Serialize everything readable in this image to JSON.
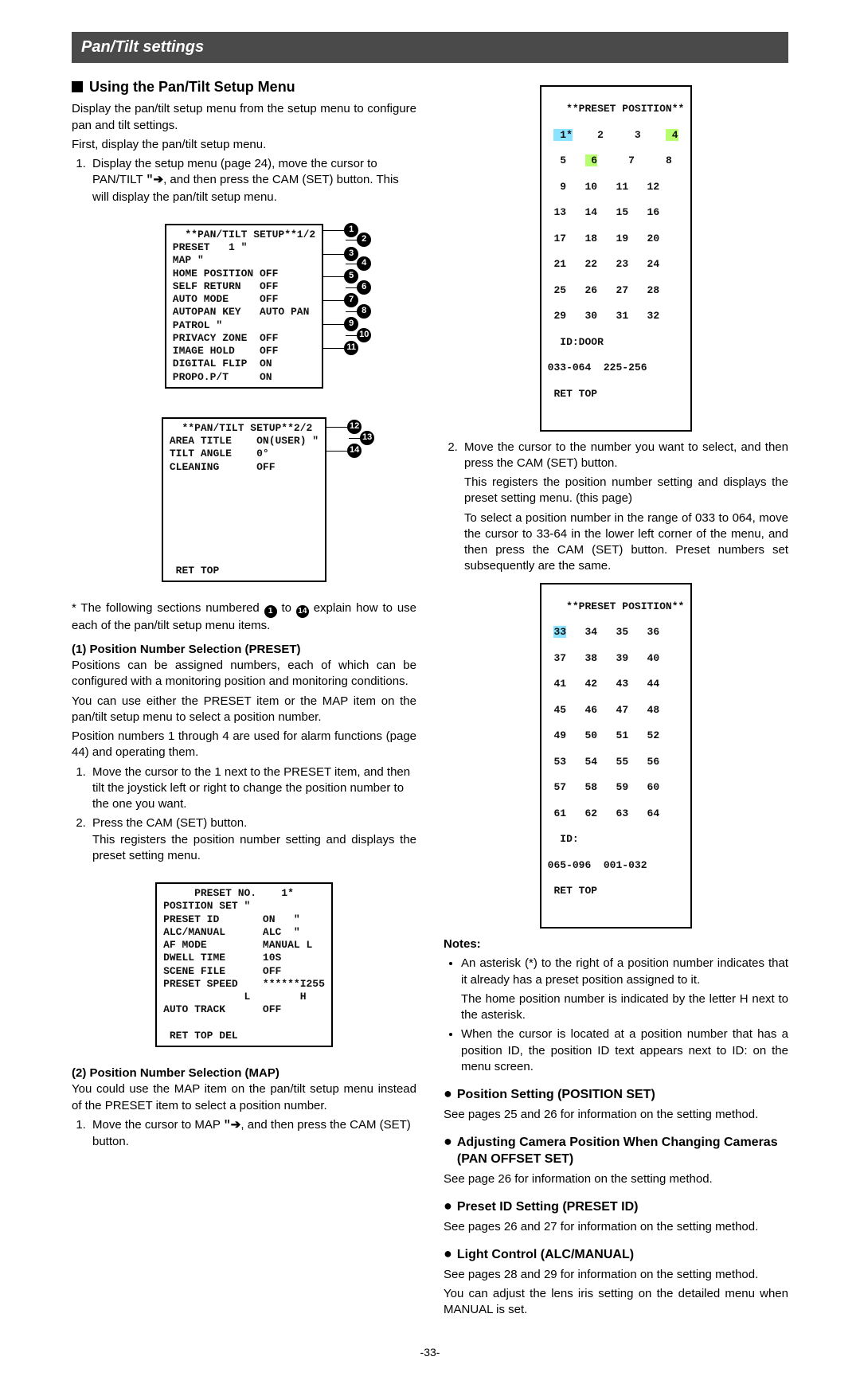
{
  "title_bar": "Pan/Tilt settings",
  "left": {
    "h2": "Using the Pan/Tilt Setup Menu",
    "intro1": "Display the pan/tilt setup menu from the setup menu to configure pan and tilt settings.",
    "intro2": "First, display the pan/tilt setup menu.",
    "step1a": "Display the setup menu (page 24), move the cursor to PAN/TILT ",
    "step1b": ", and then press the CAM (SET) button. This will display the pan/tilt setup menu.",
    "menu1": "  **PAN/TILT SETUP**1/2\nPRESET   1 \"\nMAP \"\nHOME POSITION OFF\nSELF RETURN   OFF\nAUTO MODE     OFF\nAUTOPAN KEY   AUTO PAN\nPATROL \"\nPRIVACY ZONE  OFF\nIMAGE HOLD    OFF\nDIGITAL FLIP  ON\nPROPO.P/T     ON",
    "menu2": "  **PAN/TILT SETUP**2/2\nAREA TITLE    ON(USER) \"\nTILT ANGLE    0°\nCLEANING      OFF\n\n\n\n\n\n\n\n RET TOP",
    "foot_a": " * The following sections numbered ",
    "foot_b": " to ",
    "foot_c": " explain how to use each of the pan/tilt setup menu items.",
    "sec1_title": "(1) Position Number Selection (PRESET)",
    "sec1_p1": "Positions can be assigned numbers, each of which can be configured with a monitoring position and monitoring conditions.",
    "sec1_p2": "You can use either the PRESET item or the MAP item on the pan/tilt setup menu to select a position number.",
    "sec1_p3": "Position numbers 1 through 4 are used for alarm functions (page 44) and operating them.",
    "sec1_step1": "Move the cursor to the 1 next to the PRESET item, and then tilt the joystick left or right to change the position number to the one you want.",
    "sec1_step2a": "Press the CAM (SET) button.",
    "sec1_step2b": "This registers the position number setting and displays the preset setting menu.",
    "preset_no_menu": "     PRESET NO.    1*  \nPOSITION SET \"\nPRESET ID       ON   \"\nALC/MANUAL      ALC  \"\nAF MODE         MANUAL L\nDWELL TIME      10S\nSCENE FILE      OFF\nPRESET SPEED    ******I255\n             L        H\nAUTO TRACK      OFF\n\n RET TOP DEL",
    "sec2_title": "(2) Position Number Selection (MAP)",
    "sec2_p1": "You could use the MAP item on the pan/tilt setup menu instead of the PRESET item to select a position number.",
    "sec2_step1a": "Move the cursor to MAP ",
    "sec2_step1b": ", and then press the CAM (SET) button."
  },
  "right": {
    "preset_pos_1_title": "**PRESET POSITION**",
    "preset_pos_1_rows": [
      [
        " 1*",
        " 2",
        " 3",
        " 4"
      ],
      [
        " 5",
        " 6",
        " 7",
        " 8"
      ],
      [
        " 9",
        "10",
        "11",
        "12"
      ],
      [
        "13",
        "14",
        "15",
        "16"
      ],
      [
        "17",
        "18",
        "19",
        "20"
      ],
      [
        "21",
        "22",
        "23",
        "24"
      ],
      [
        "25",
        "26",
        "27",
        "28"
      ],
      [
        "29",
        "30",
        "31",
        "32"
      ]
    ],
    "preset_pos_1_id": "  ID:DOOR",
    "preset_pos_1_range": "033-064  225-256",
    "preset_pos_1_ret": " RET TOP",
    "step2a": "Move the cursor to the number you want to select, and then press the CAM (SET) button.",
    "step2b": "This registers the position number setting and displays the preset setting menu. (this page)",
    "step2c": "To select a position number in the range of 033 to 064, move the cursor to 33-64 in the lower left corner of the menu, and then press the CAM (SET) button. Preset numbers set subsequently are the same.",
    "preset_pos_2_title": "**PRESET POSITION**",
    "preset_pos_2_rows": [
      [
        "33",
        "34",
        "35",
        "36"
      ],
      [
        "37",
        "38",
        "39",
        "40"
      ],
      [
        "41",
        "42",
        "43",
        "44"
      ],
      [
        "45",
        "46",
        "47",
        "48"
      ],
      [
        "49",
        "50",
        "51",
        "52"
      ],
      [
        "53",
        "54",
        "55",
        "56"
      ],
      [
        "57",
        "58",
        "59",
        "60"
      ],
      [
        "61",
        "62",
        "63",
        "64"
      ]
    ],
    "preset_pos_2_id": "  ID:",
    "preset_pos_2_range": "065-096  001-032",
    "preset_pos_2_ret": " RET TOP",
    "notes_title": "Notes:",
    "note1a": "An asterisk (*) to the right of a position number indicates that it already has a preset position assigned to it.",
    "note1b": "The home position number is indicated by the letter H next to the asterisk.",
    "note2": "When the cursor is located at a position number that has a position ID, the position ID text appears next to ID: on the menu screen.",
    "h_position_set": "Position Setting (POSITION SET)",
    "position_set_p": "See pages 25 and 26 for information on the setting method.",
    "h_adjust_cam": "Adjusting Camera Position When Changing Cameras (PAN OFFSET SET)",
    "adjust_cam_p": "See page 26 for information on the setting method.",
    "h_preset_id": "Preset ID Setting (PRESET ID)",
    "preset_id_p": "See pages 26 and 27 for information on the setting method.",
    "h_light_ctrl": "Light Control (ALC/MANUAL)",
    "light_p1": "See pages 28 and 29 for information on the setting method.",
    "light_p2": "You can adjust the lens iris setting on the detailed menu when MANUAL is set."
  },
  "page_num": "-33-",
  "callouts": [
    "1",
    "2",
    "3",
    "4",
    "5",
    "6",
    "7",
    "8",
    "9",
    "10",
    "11",
    "12",
    "13",
    "14"
  ],
  "chart_data": {
    "type": "table",
    "title": "Preset position ranges shown in menus",
    "tables": [
      {
        "range": "033-064",
        "paired_with": "225-256",
        "grid_start": 1,
        "grid_end": 32
      },
      {
        "range": "065-096",
        "paired_with": "001-032",
        "grid_start": 33,
        "grid_end": 64
      }
    ]
  }
}
